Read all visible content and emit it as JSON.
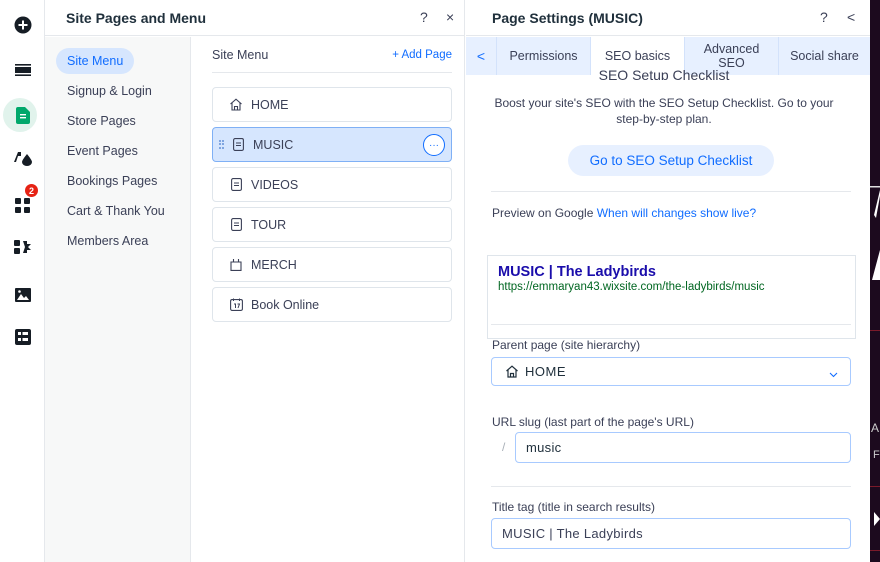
{
  "rail": {
    "icons": [
      "add-icon",
      "menu-layers-icon",
      "pages-icon",
      "design-icon",
      "apps-icon",
      "business-tools-icon",
      "media-icon",
      "cms-icon"
    ],
    "apps_badge": "2",
    "active": "pages-icon",
    "accent": "#00a86b"
  },
  "pages_panel": {
    "title": "Site Pages and Menu",
    "help": "?",
    "close": "×",
    "categories": [
      {
        "label": "Site Menu",
        "active": true
      },
      {
        "label": "Signup & Login"
      },
      {
        "label": "Store Pages"
      },
      {
        "label": "Event Pages"
      },
      {
        "label": "Bookings Pages"
      },
      {
        "label": "Cart & Thank You"
      },
      {
        "label": "Members Area"
      }
    ],
    "list_title": "Site Menu",
    "add_page": "+ Add Page",
    "pages": [
      {
        "label": "HOME",
        "icon": "home-icon"
      },
      {
        "label": "MUSIC",
        "icon": "page-icon",
        "selected": true
      },
      {
        "label": "VIDEOS",
        "icon": "page-icon"
      },
      {
        "label": "TOUR",
        "icon": "page-icon"
      },
      {
        "label": "MERCH",
        "icon": "shopping-bag-icon"
      },
      {
        "label": "Book Online",
        "icon": "calendar-icon"
      }
    ],
    "more_actions": "···"
  },
  "settings_panel": {
    "title": "Page Settings (MUSIC)",
    "help": "?",
    "collapse": "<",
    "tab_back": "<",
    "tabs": [
      {
        "label": "Permissions"
      },
      {
        "label": "SEO basics",
        "active": true
      },
      {
        "label": "Advanced SEO"
      },
      {
        "label": "Social share"
      }
    ],
    "checklist_title": "SEO Setup Checklist",
    "checklist_desc": "Boost your site's SEO with the SEO Setup Checklist. Go to your step-by-step plan.",
    "checklist_button": "Go to SEO Setup Checklist",
    "preview_label": "Preview on Google",
    "preview_link": "When will changes show live?",
    "google_title": "MUSIC | The Ladybirds",
    "google_url": "https://emmaryan43.wixsite.com/the-ladybirds/music",
    "parent_label": "Parent page (site hierarchy)",
    "parent_value": "HOME",
    "slug_label": "URL slug (last part of the page's URL)",
    "slug_prefix": "/",
    "slug_value": "music",
    "title_tag_label": "Title tag (title in search results)",
    "title_tag_value": "MUSIC | The Ladybirds"
  },
  "colors": {
    "accent": "#116dff",
    "selected_bg": "#d6e6fe",
    "tabs_bg": "#e7f0ff",
    "google_title": "#1a0dab",
    "google_url": "#006621",
    "badge": "#e62214"
  }
}
